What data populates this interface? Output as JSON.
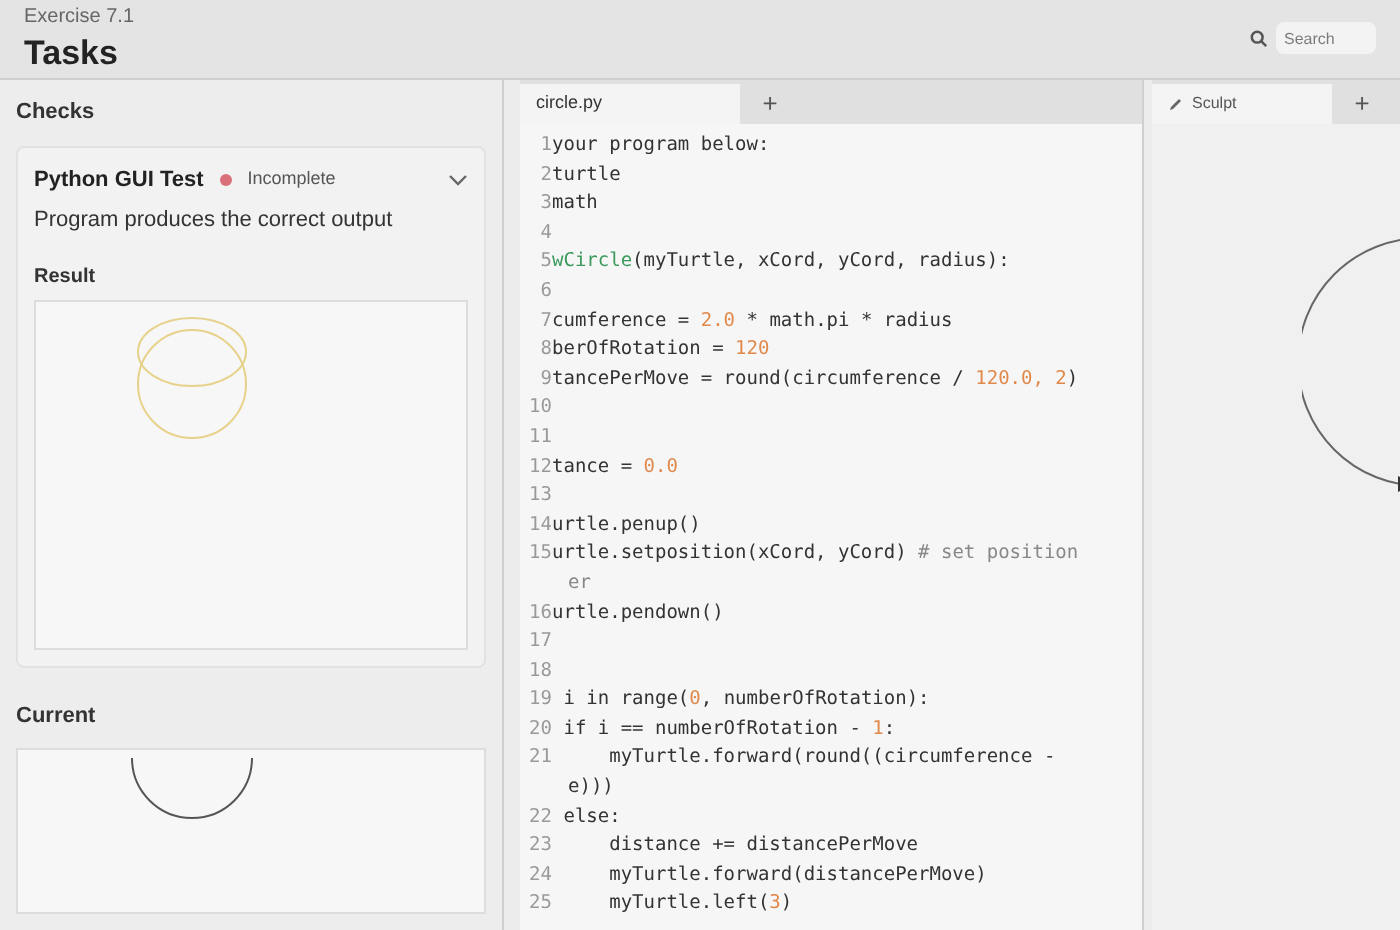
{
  "header": {
    "breadcrumb": "Exercise 7.1",
    "title": "Tasks",
    "search": {
      "placeholder": "Search"
    }
  },
  "checks": {
    "label": "Checks",
    "items": [
      {
        "name": "Python GUI Test",
        "status": "Incomplete",
        "color": "#d9707a",
        "description": "Program produces the correct output",
        "expanded": false
      }
    ]
  },
  "result": {
    "label": "Result"
  },
  "current": {
    "label": "Current"
  },
  "editor": {
    "tabs": [
      {
        "label": "circle.py",
        "selected": true
      }
    ],
    "add_tab": "+",
    "lines": [
      {
        "number": "1",
        "segments": [
          {
            "kind": "plain",
            "text": "your program below:"
          }
        ]
      },
      {
        "number": "2",
        "segments": [
          {
            "kind": "plain",
            "text": "turtle"
          }
        ]
      },
      {
        "number": "3",
        "segments": [
          {
            "kind": "plain",
            "text": "math"
          }
        ]
      },
      {
        "number": "4"
      },
      {
        "number": "5",
        "segments": [
          {
            "kind": "func",
            "text": "wCircle"
          },
          {
            "kind": "plain",
            "text": "(myTurtle, xCord, yCord, radius):"
          }
        ]
      },
      {
        "number": "6"
      },
      {
        "number": "7",
        "segments": [
          {
            "kind": "plain",
            "text": "cumference = "
          },
          {
            "kind": "num",
            "text": "2.0"
          },
          {
            "kind": "plain",
            "text": " * math.pi * radius"
          }
        ]
      },
      {
        "number": "8",
        "segments": [
          {
            "kind": "plain",
            "text": "berOfRotation = "
          },
          {
            "kind": "num",
            "text": "120"
          }
        ]
      },
      {
        "number": "9",
        "segments": [
          {
            "kind": "plain",
            "text": "tancePerMove = round(circumference / "
          },
          {
            "kind": "num",
            "text": "120.0, 2"
          },
          {
            "kind": "plain",
            "text": ")"
          }
        ]
      },
      {
        "number": "10"
      },
      {
        "number": "11"
      },
      {
        "number": "12",
        "segments": [
          {
            "kind": "plain",
            "text": "tance = "
          },
          {
            "kind": "num",
            "text": "0.0"
          }
        ]
      },
      {
        "number": "13"
      },
      {
        "number": "14",
        "segments": [
          {
            "kind": "plain",
            "text": "urtle.penup()"
          }
        ]
      },
      {
        "number": "15",
        "segments": [
          {
            "kind": "plain",
            "text": "urtle.setposition(xCord, yCord) "
          },
          {
            "kind": "comment",
            "text": "# set position"
          }
        ],
        "wrap": [
          {
            "kind": "comment",
            "text": "er"
          }
        ]
      },
      {
        "number": "16",
        "segments": [
          {
            "kind": "plain",
            "text": "urtle.pendown()"
          }
        ]
      },
      {
        "number": "17"
      },
      {
        "number": "18"
      },
      {
        "number": "19",
        "segments": [
          {
            "kind": "plain",
            "text": " i in range("
          },
          {
            "kind": "num",
            "text": "0"
          },
          {
            "kind": "plain",
            "text": ", numberOfRotation):"
          }
        ]
      },
      {
        "number": "20",
        "segments": [
          {
            "kind": "plain",
            "text": " if i == numberOfRotation - "
          },
          {
            "kind": "num",
            "text": "1"
          },
          {
            "kind": "plain",
            "text": ":"
          }
        ]
      },
      {
        "number": "21",
        "segments": [
          {
            "kind": "plain",
            "text": "     myTurtle.forward(round((circumference -"
          }
        ],
        "wrap": [
          {
            "kind": "plain",
            "text": "e)))"
          }
        ]
      },
      {
        "number": "22",
        "segments": [
          {
            "kind": "plain",
            "text": " else:"
          }
        ]
      },
      {
        "number": "23",
        "segments": [
          {
            "kind": "plain",
            "text": "     distance += distancePerMove"
          }
        ]
      },
      {
        "number": "24",
        "segments": [
          {
            "kind": "plain",
            "text": "     myTurtle.forward(distancePerMove)"
          }
        ]
      },
      {
        "number": "25",
        "segments": [
          {
            "kind": "plain",
            "text": "     myTurtle.left("
          },
          {
            "kind": "num",
            "text": "3"
          },
          {
            "kind": "plain",
            "text": ")"
          }
        ]
      }
    ]
  },
  "output": {
    "tabs": [
      {
        "label": "Sculpt",
        "selected": true
      }
    ],
    "add_tab": "+"
  }
}
